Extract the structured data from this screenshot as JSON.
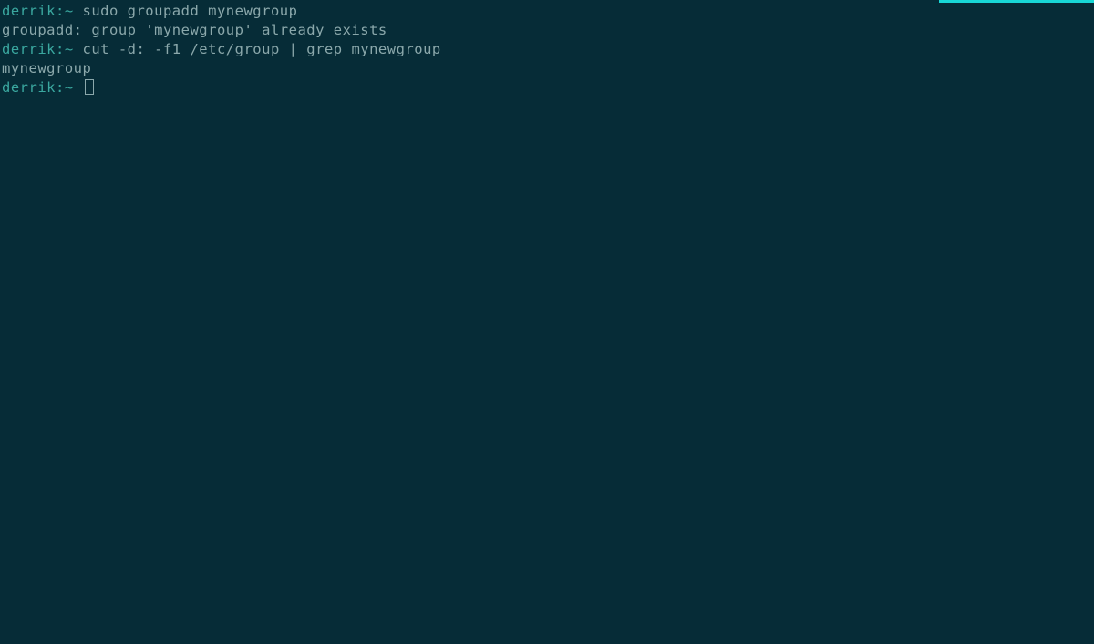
{
  "terminal": {
    "lines": [
      {
        "prompt": "derrik:~",
        "command": " sudo groupadd mynewgroup"
      },
      {
        "output": "groupadd: group 'mynewgroup' already exists"
      },
      {
        "prompt": "derrik:~",
        "command": " cut -d: -f1 /etc/group | grep mynewgroup"
      },
      {
        "output": "mynewgroup"
      },
      {
        "prompt": "derrik:~",
        "command": " ",
        "cursor": true
      }
    ]
  }
}
